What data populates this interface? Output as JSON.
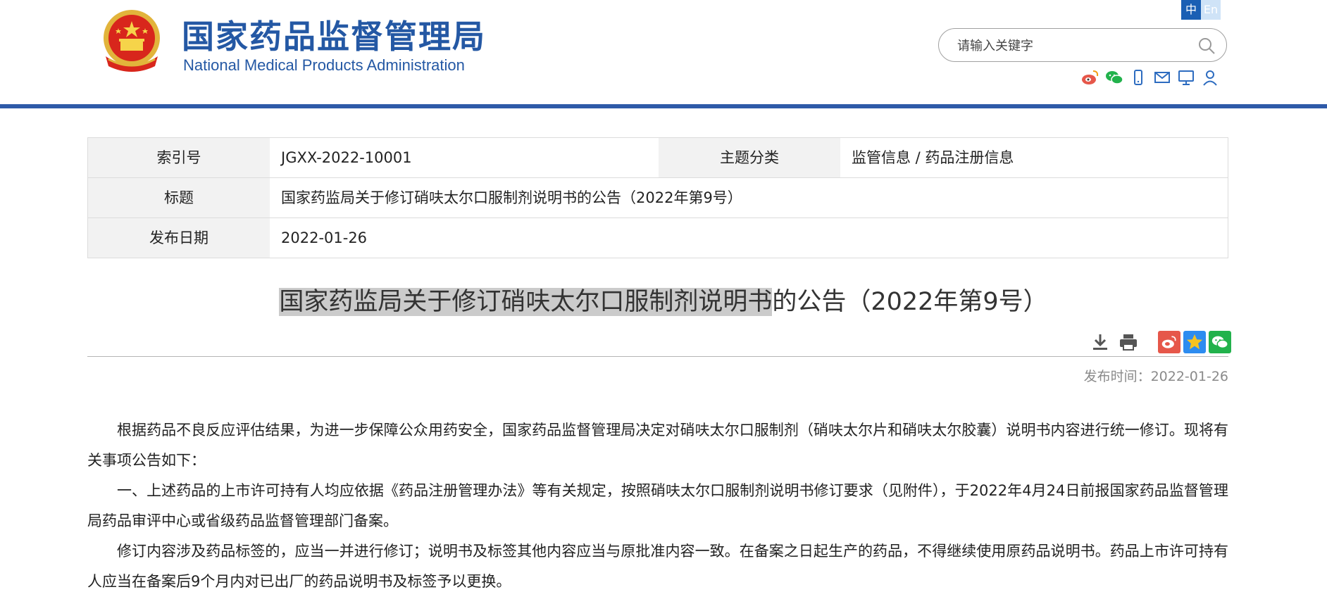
{
  "header": {
    "site_name_cn": "国家药品监督管理局",
    "site_name_en": "National Medical Products Administration",
    "lang_zh": "中",
    "lang_en": "En",
    "search_placeholder": "请输入关键字",
    "share_icons": [
      "weibo-icon",
      "wechat-icon",
      "mobile-icon",
      "mail-icon",
      "screen-icon",
      "user-icon"
    ]
  },
  "info_table": {
    "index_label": "索引号",
    "index_value": "JGXX-2022-10001",
    "topic_label": "主题分类",
    "topic_value": "监管信息 / 药品注册信息",
    "title_label": "标题",
    "title_value": "国家药监局关于修订硝呋太尔口服制剂说明书的公告（2022年第9号）",
    "date_label": "发布日期",
    "date_value": "2022-01-26"
  },
  "article": {
    "title_highlighted": "国家药监局关于修订硝呋太尔口服制剂说明书",
    "title_rest": "的公告（2022年第9号）",
    "publish_time": "发布时间：2022-01-26",
    "paragraphs": [
      "根据药品不良反应评估结果，为进一步保障公众用药安全，国家药品监督管理局决定对硝呋太尔口服制剂（硝呋太尔片和硝呋太尔胶囊）说明书内容进行统一修订。现将有关事项公告如下：",
      "一、上述药品的上市许可持有人均应依据《药品注册管理办法》等有关规定，按照硝呋太尔口服制剂说明书修订要求（见附件），于2022年4月24日前报国家药品监督管理局药品审评中心或省级药品监督管理部门备案。",
      "修订内容涉及药品标签的，应当一并进行修订；说明书及标签其他内容应当与原批准内容一致。在备案之日起生产的药品，不得继续使用原药品说明书。药品上市许可持有人应当在备案后9个月内对已出厂的药品说明书及标签予以更换。"
    ]
  },
  "colors": {
    "brand_blue": "#2458a4",
    "header_line": "#2e5aa8",
    "weibo_red": "#e6574a",
    "wechat_green": "#22b24c",
    "qzone_blue": "#2d8cf0"
  }
}
